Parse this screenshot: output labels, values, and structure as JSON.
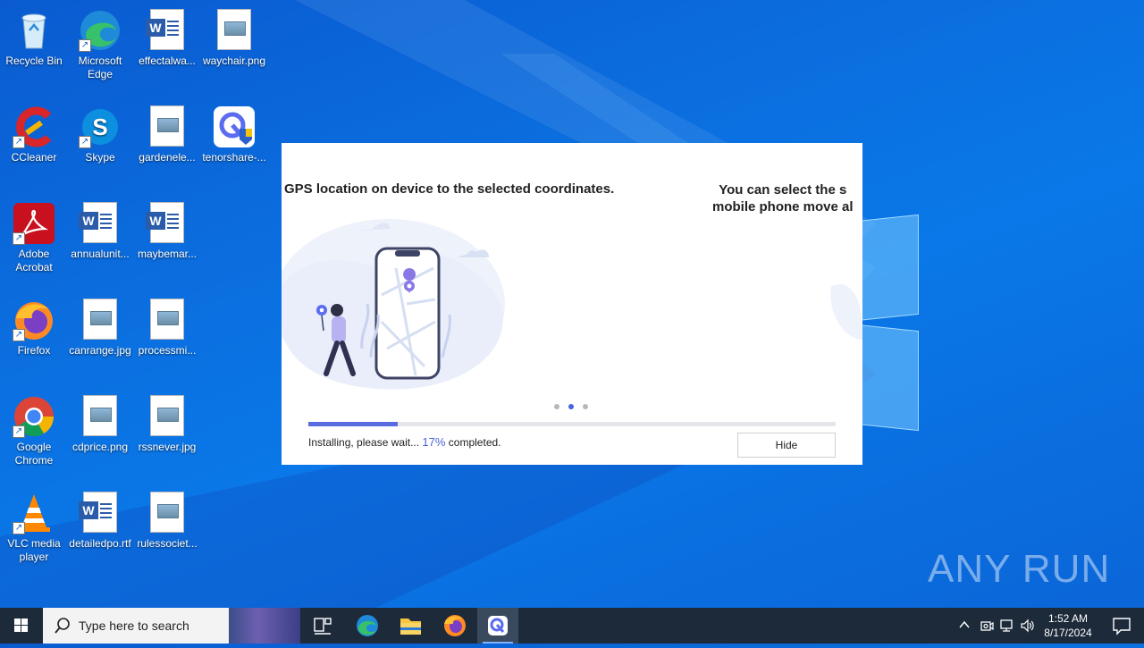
{
  "desktop_icons": [
    {
      "label": "Recycle Bin"
    },
    {
      "label": "Microsoft Edge"
    },
    {
      "label": "effectalwa..."
    },
    {
      "label": "waychair.png"
    },
    {
      "label": "CCleaner"
    },
    {
      "label": "Skype"
    },
    {
      "label": "gardenele..."
    },
    {
      "label": "tenorshare-..."
    },
    {
      "label": "Adobe Acrobat"
    },
    {
      "label": "annualunit..."
    },
    {
      "label": "maybemar..."
    },
    {
      "label": "Firefox"
    },
    {
      "label": "canrange.jpg"
    },
    {
      "label": "processmi..."
    },
    {
      "label": "Google Chrome"
    },
    {
      "label": "cdprice.png"
    },
    {
      "label": "rssnever.jpg"
    },
    {
      "label": "VLC media player"
    },
    {
      "label": "detailedpo.rtf"
    },
    {
      "label": "rulessociet..."
    }
  ],
  "installer": {
    "slide_left_text": "GPS location on device to the selected coordinates.",
    "slide_right_line1": "You can select the s",
    "slide_right_line2": "mobile phone move al",
    "progress_fraction": 0.17,
    "status_prefix": "Installing, please wait...",
    "status_percent": "17%",
    "status_suffix": "completed.",
    "hide_label": "Hide"
  },
  "watermark": "ANY RUN",
  "taskbar": {
    "search_placeholder": "Type here to search",
    "time": "1:52 AM",
    "date": "8/17/2024"
  },
  "colors": {
    "accent": "#4a63d8",
    "progress": "#5a6be0",
    "taskbar": "#1c2a3a"
  }
}
